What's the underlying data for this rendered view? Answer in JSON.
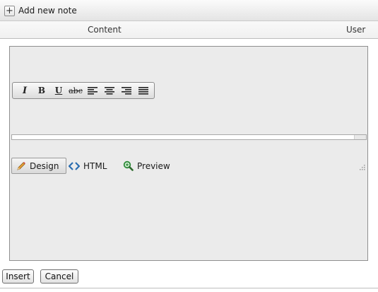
{
  "toolbar": {
    "add_note_label": "Add new note",
    "add_icon": "plus-icon"
  },
  "grid": {
    "columns": [
      "Content",
      "User"
    ]
  },
  "editor": {
    "formatting": {
      "italic": "I",
      "bold": "B",
      "underline": "U",
      "strikethrough": "abc",
      "align": [
        "align-left-icon",
        "align-center-icon",
        "align-right-icon",
        "align-justify-icon"
      ]
    },
    "modes": [
      {
        "label": "Design",
        "icon": "pencil-icon",
        "active": true
      },
      {
        "label": "HTML",
        "icon": "code-brackets-icon",
        "active": false
      },
      {
        "label": "Preview",
        "icon": "magnifier-icon",
        "active": false
      }
    ]
  },
  "actions": {
    "insert_label": "Insert",
    "cancel_label": "Cancel"
  },
  "colors": {
    "editor_bg": "#ebebeb",
    "html_icon": "#2a6db0",
    "preview_icon": "#2e8b3a"
  }
}
